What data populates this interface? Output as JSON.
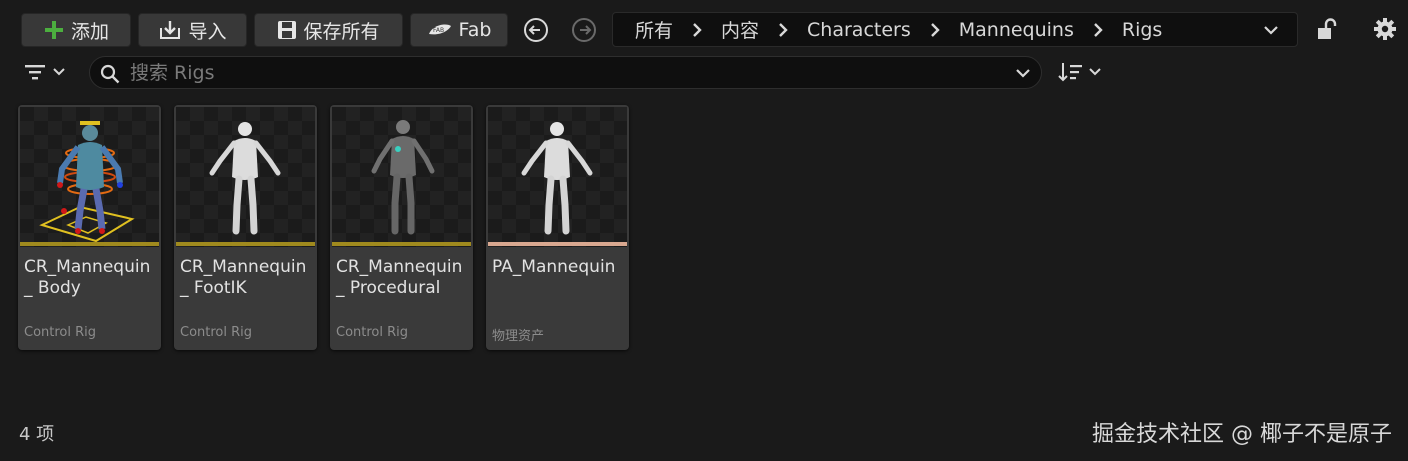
{
  "toolbar": {
    "add_label": "添加",
    "import_label": "导入",
    "save_all_label": "保存所有",
    "fab_label": "Fab"
  },
  "breadcrumb": [
    "所有",
    "内容",
    "Characters",
    "Mannequins",
    "Rigs"
  ],
  "search": {
    "placeholder": "搜索 Rigs",
    "value": ""
  },
  "assets": [
    {
      "name": "CR_Mannequin_ Body",
      "type": "Control Rig",
      "accent": "#a08a1e",
      "thumbnail": "mannequin-control-rig-body"
    },
    {
      "name": "CR_Mannequin_ FootIK",
      "type": "Control Rig",
      "accent": "#a08a1e",
      "thumbnail": "mannequin-white"
    },
    {
      "name": "CR_Mannequin_ Procedural",
      "type": "Control Rig",
      "accent": "#a08a1e",
      "thumbnail": "mannequin-dark"
    },
    {
      "name": "PA_Mannequin",
      "type": "物理资产",
      "accent": "#d9a890",
      "thumbnail": "mannequin-white"
    }
  ],
  "status": {
    "item_count": "4 项"
  },
  "watermark": "掘金技术社区 @ 椰子不是原子",
  "colors": {
    "background": "#1a1a1a",
    "button": "#383838",
    "control_rig_accent": "#a08a1e",
    "physics_asset_accent": "#d9a890",
    "add_icon": "#3fae3f"
  }
}
